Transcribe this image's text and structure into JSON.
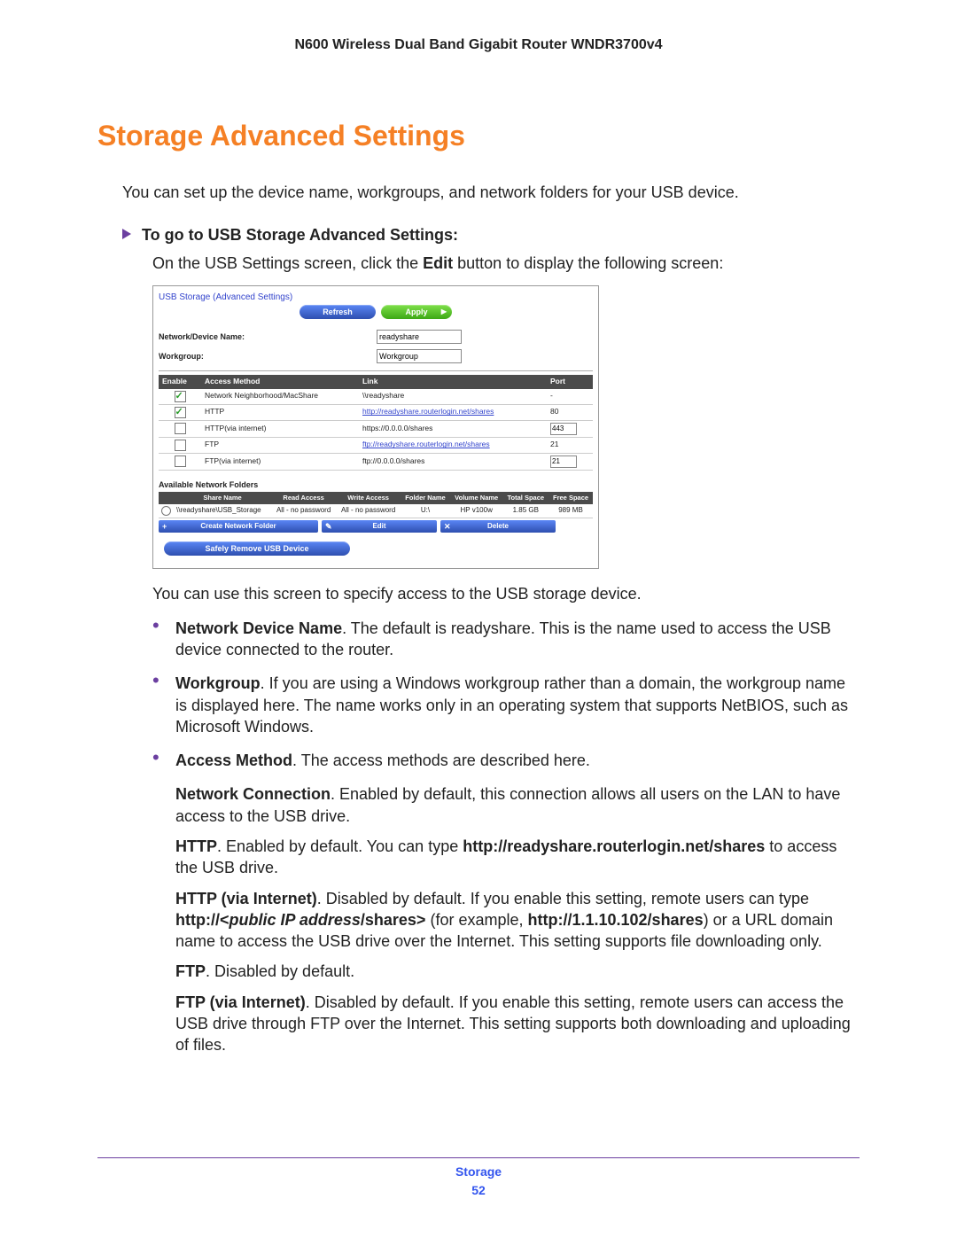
{
  "doc_header": "N600 Wireless Dual Band Gigabit Router WNDR3700v4",
  "section_title": "Storage Advanced Settings",
  "intro": "You can set up the device name, workgroups, and network folders for your USB device.",
  "step_heading": "To go to USB Storage Advanced Settings:",
  "step_line_pre": "On the USB Settings screen, click the ",
  "step_line_bold": "Edit",
  "step_line_post": " button to display the following screen:",
  "shot": {
    "title": "USB Storage (Advanced Settings)",
    "btn_refresh": "Refresh",
    "btn_apply": "Apply",
    "lbl_device": "Network/Device Name:",
    "val_device": "readyshare",
    "lbl_workgroup": "Workgroup:",
    "val_workgroup": "Workgroup",
    "th_enable": "Enable",
    "th_method": "Access Method",
    "th_link": "Link",
    "th_port": "Port",
    "rows": [
      {
        "checked": true,
        "method": "Network Neighborhood/MacShare",
        "link": "\\\\readyshare",
        "is_link": false,
        "port": "-",
        "port_input": false
      },
      {
        "checked": true,
        "method": "HTTP",
        "link": "http://readyshare.routerlogin.net/shares",
        "is_link": true,
        "port": "80",
        "port_input": false
      },
      {
        "checked": false,
        "method": "HTTP(via internet)",
        "link": "https://0.0.0.0/shares",
        "is_link": false,
        "port": "443",
        "port_input": true
      },
      {
        "checked": false,
        "method": "FTP",
        "link": "ftp://readyshare.routerlogin.net/shares",
        "is_link": true,
        "port": "21",
        "port_input": false
      },
      {
        "checked": false,
        "method": "FTP(via internet)",
        "link": "ftp://0.0.0.0/shares",
        "is_link": false,
        "port": "21",
        "port_input": true
      }
    ],
    "avail_label": "Available Network Folders",
    "fth": {
      "share": "Share Name",
      "read": "Read Access",
      "write": "Write Access",
      "folder": "Folder Name",
      "vol": "Volume Name",
      "total": "Total Space",
      "free": "Free Space"
    },
    "frow": {
      "share": "\\\\readyshare\\USB_Storage",
      "read": "All - no password",
      "write": "All - no password",
      "folder": "U:\\",
      "vol": "HP v100w",
      "total": "1.85 GB",
      "free": "989 MB"
    },
    "btn_create": "Create Network Folder",
    "btn_edit": "Edit",
    "btn_delete": "Delete",
    "btn_safe": "Safely Remove USB Device"
  },
  "after_shot": "You can use this screen to specify access to the USB storage device.",
  "b1_t": "Network Device Name",
  "b1_body": ". The default is readyshare. This is the name used to access the USB device connected to the router.",
  "b2_t": "Workgroup",
  "b2_body": ". If you are using a Windows workgroup rather than a domain, the workgroup name is displayed here. The name works only in an operating system that supports NetBIOS, such as Microsoft Windows.",
  "b3_t": "Access Method",
  "b3_body": ". The access methods are described here.",
  "s1_t": "Network Connection",
  "s1_body": ". Enabled by default, this connection allows all users on the LAN to have access to the USB drive.",
  "s2_t": "HTTP",
  "s2_mid": ". Enabled by default. You can type ",
  "s2_bold": "http://readyshare.routerlogin.net/shares",
  "s2_end": " to access the USB drive.",
  "s3_t": "HTTP (via Internet)",
  "s3_a": ". Disabled by default. If you enable this setting, remote users can type ",
  "s3_b": "http://<",
  "s3_c": "public IP address",
  "s3_d": "/shares>",
  "s3_e": " (for example, ",
  "s3_f": "http://1.1.10.102/shares",
  "s3_g": ") or a URL domain name to access the USB drive over the Internet. This setting supports file downloading only.",
  "s4_t": "FTP",
  "s4_body": ". Disabled by default.",
  "s5_t": "FTP (via Internet)",
  "s5_body": ". Disabled by default. If you enable this setting, remote users can access the USB drive through FTP over the Internet. This setting supports both downloading and uploading of files.",
  "footer_label": "Storage",
  "footer_page": "52"
}
